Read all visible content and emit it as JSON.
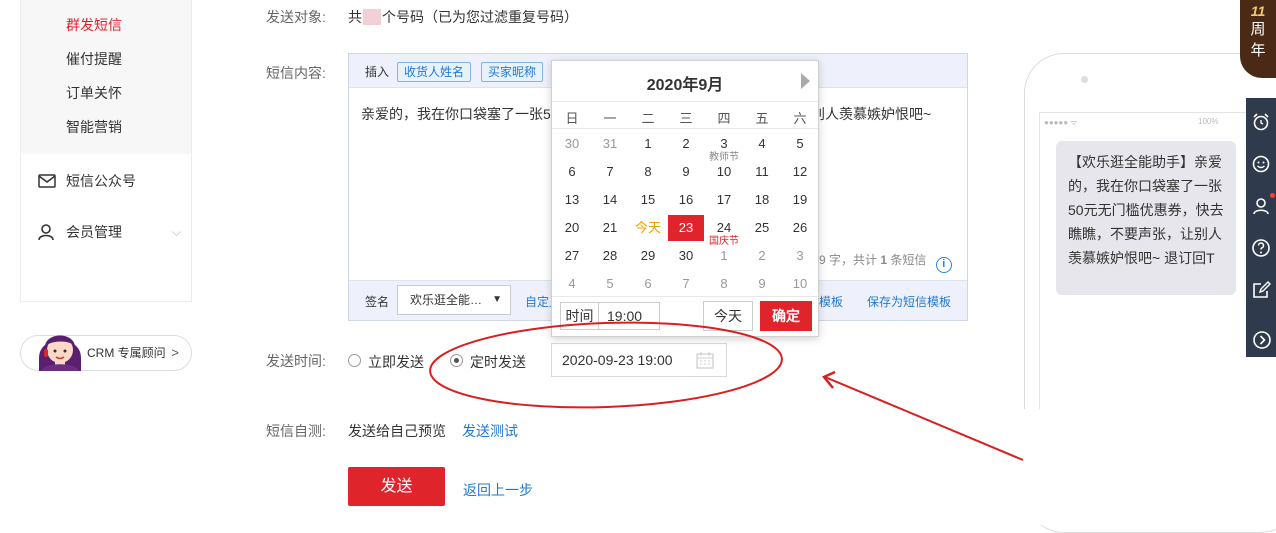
{
  "sidebar": {
    "sub_items": [
      {
        "label": "群发短信",
        "active": true
      },
      {
        "label": "催付提醒",
        "active": false
      },
      {
        "label": "订单关怀",
        "active": false
      },
      {
        "label": "智能营销",
        "active": false
      }
    ],
    "nav_items": [
      {
        "label": "短信公众号",
        "icon": "mail-icon"
      },
      {
        "label": "会员管理",
        "icon": "user-icon"
      }
    ],
    "crm_label": "CRM 专属顾问",
    "crm_arrow": ">"
  },
  "form": {
    "target_label": "发送对象:",
    "target_prefix": "共",
    "target_suffix": "个号码（已为您过滤重复号码）",
    "content_label": "短信内容:",
    "insert_label": "插入",
    "insert_tags": [
      "收货人姓名",
      "买家昵称"
    ],
    "content_text_left": "亲爱的，我在你口袋塞了一张5",
    "content_text_right": "让别人羡慕嫉妒恨吧~",
    "count_text_prefix": "9 字，共计",
    "count_number": "1",
    "count_text_suffix": "条短信",
    "info_icon": "i",
    "signature_label": "签名",
    "signature_value": "欢乐逛全能…",
    "custom_link": "自定义",
    "template_link": "模板",
    "save_template_link": "保存为短信模板",
    "time_label": "发送时间:",
    "send_now_label": "立即发送",
    "scheduled_label": "定时发送",
    "send_mode": "scheduled",
    "datetime_value": "2020-09-23 19:00",
    "selftest_label": "短信自测:",
    "selftest_text": "发送给自己预览",
    "send_test_link": "发送测试",
    "send_button": "发送",
    "back_link": "返回上一步"
  },
  "calendar": {
    "title": "2020年9月",
    "weekdays": [
      "日",
      "一",
      "二",
      "三",
      "四",
      "五",
      "六"
    ],
    "weeks": [
      [
        {
          "d": "30",
          "m": "prev"
        },
        {
          "d": "31",
          "m": "prev"
        },
        {
          "d": "1",
          "m": "cur"
        },
        {
          "d": "2",
          "m": "cur"
        },
        {
          "d": "3",
          "m": "cur"
        },
        {
          "d": "4",
          "m": "cur"
        },
        {
          "d": "5",
          "m": "cur"
        }
      ],
      [
        {
          "d": "6",
          "m": "cur"
        },
        {
          "d": "7",
          "m": "cur"
        },
        {
          "d": "8",
          "m": "cur"
        },
        {
          "d": "9",
          "m": "cur"
        },
        {
          "d": "10",
          "m": "cur",
          "holiday": "教师节",
          "holiday_gray": true
        },
        {
          "d": "11",
          "m": "cur"
        },
        {
          "d": "12",
          "m": "cur"
        }
      ],
      [
        {
          "d": "13",
          "m": "cur"
        },
        {
          "d": "14",
          "m": "cur"
        },
        {
          "d": "15",
          "m": "cur"
        },
        {
          "d": "16",
          "m": "cur"
        },
        {
          "d": "17",
          "m": "cur"
        },
        {
          "d": "18",
          "m": "cur"
        },
        {
          "d": "19",
          "m": "cur"
        }
      ],
      [
        {
          "d": "20",
          "m": "cur"
        },
        {
          "d": "21",
          "m": "cur"
        },
        {
          "d": "今天",
          "m": "today"
        },
        {
          "d": "23",
          "m": "sel"
        },
        {
          "d": "24",
          "m": "cur2"
        },
        {
          "d": "25",
          "m": "cur2"
        },
        {
          "d": "26",
          "m": "cur2"
        }
      ],
      [
        {
          "d": "27",
          "m": "cur2"
        },
        {
          "d": "28",
          "m": "cur2"
        },
        {
          "d": "29",
          "m": "cur2"
        },
        {
          "d": "30",
          "m": "cur2"
        },
        {
          "d": "1",
          "m": "next",
          "holiday": "国庆节"
        },
        {
          "d": "2",
          "m": "next"
        },
        {
          "d": "3",
          "m": "next"
        }
      ],
      [
        {
          "d": "4",
          "m": "next"
        },
        {
          "d": "5",
          "m": "next"
        },
        {
          "d": "6",
          "m": "next"
        },
        {
          "d": "7",
          "m": "next"
        },
        {
          "d": "8",
          "m": "next"
        },
        {
          "d": "9",
          "m": "next"
        },
        {
          "d": "10",
          "m": "next"
        }
      ]
    ],
    "time_label": "时间",
    "time_value": "19:00",
    "today_button": "今天",
    "ok_button": "确定"
  },
  "preview": {
    "status_left": "●●●●● ᯤ",
    "status_right": "100%",
    "message": "【欢乐逛全能助手】亲爱的，我在你口袋塞了一张50元无门槛优惠券，快去瞧瞧，不要声张，让别人羡慕嫉妒恨吧~ 退订回T"
  },
  "anniversary": {
    "number": "11",
    "chars": [
      "周",
      "年"
    ]
  },
  "toolbar_icons": [
    "alarm-icon",
    "smile-icon",
    "service-icon",
    "help-icon",
    "edit-icon",
    "arrow-right-icon"
  ],
  "colors": {
    "accent": "#e0242b",
    "link": "#1f7ad0",
    "toolbar": "#2f3b4d",
    "annotation": "#d92020"
  }
}
